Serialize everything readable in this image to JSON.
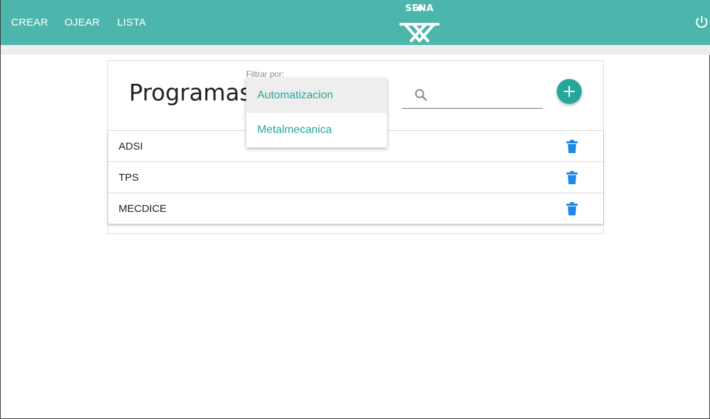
{
  "nav": {
    "items": [
      {
        "label": "CREAR"
      },
      {
        "label": "OJEAR"
      },
      {
        "label": "LISTA"
      }
    ],
    "logo_text": "SENA",
    "power_icon": "power-icon"
  },
  "colors": {
    "primary": "#4db6ac",
    "accent": "#26a69a",
    "delete": "#1e88e5"
  },
  "main": {
    "title": "Programas",
    "filter": {
      "label": "Filtrar por:",
      "options": [
        {
          "label": "Automatizacion",
          "highlighted": true
        },
        {
          "label": "Metalmecanica",
          "highlighted": false
        }
      ]
    },
    "search": {
      "icon": "search-icon",
      "value": "",
      "placeholder": ""
    },
    "add_button_icon": "plus-icon",
    "rows": [
      {
        "label": "ADSI",
        "action_icon": "trash-icon"
      },
      {
        "label": "TPS",
        "action_icon": "trash-icon"
      },
      {
        "label": "MECDICE",
        "action_icon": "trash-icon"
      }
    ]
  }
}
